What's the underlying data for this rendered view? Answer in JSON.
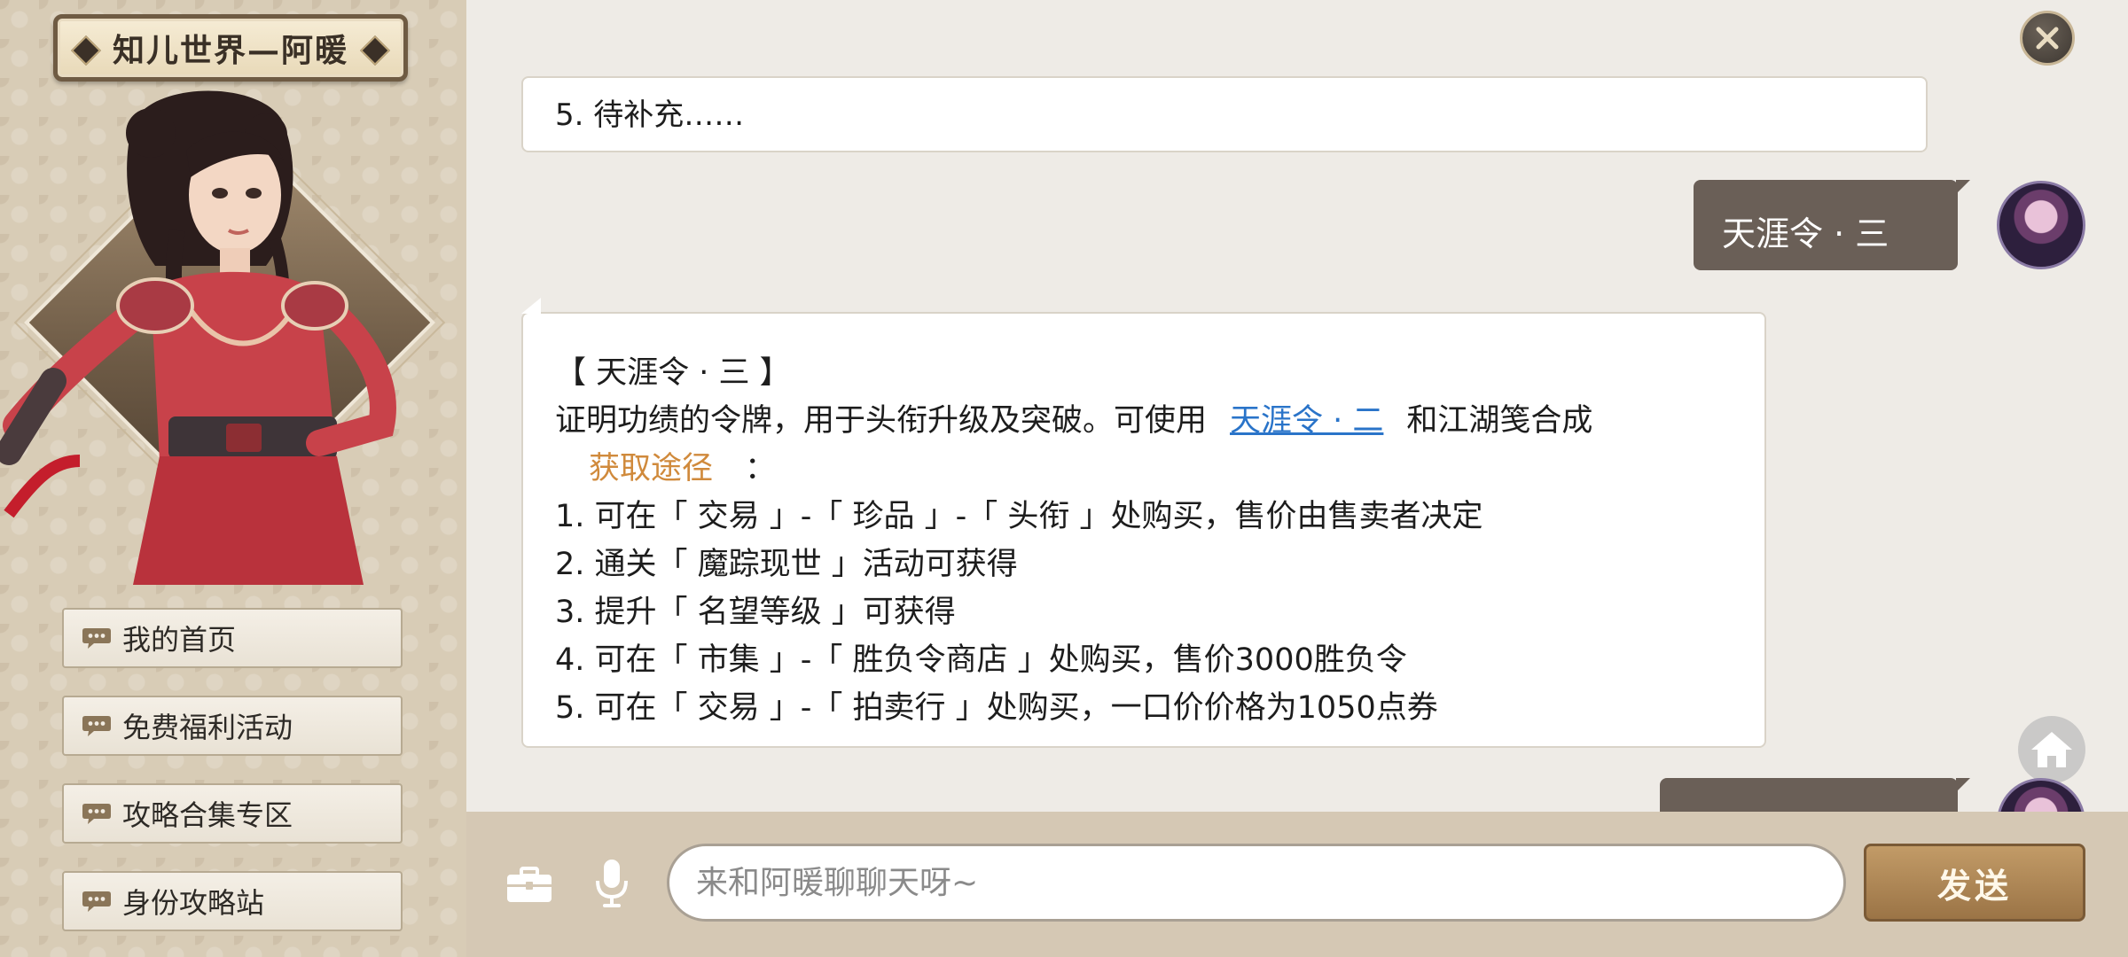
{
  "sidebar": {
    "title": "知儿世界—阿暖",
    "menu": [
      {
        "label": "我的首页"
      },
      {
        "label": "免费福利活动"
      },
      {
        "label": "攻略合集专区"
      },
      {
        "label": "身份攻略站"
      }
    ]
  },
  "chat": {
    "top_card_text": "5. 待补充……",
    "user_message_1": "天涯令 · 三",
    "main_card": {
      "heading": "【 天涯令 · 三 】",
      "desc_before": "证明功绩的令牌，用于头衔升级及突破。可使用",
      "desc_link": "天涯令 · 二",
      "desc_after": "和江湖笺合成",
      "obtain_label": "获取途径",
      "obtain_colon": "：",
      "items": [
        "1. 可在「 交易 」-「 珍品 」-「 头衔 」处购买，售价由售卖者决定",
        "2. 通关「 魔踪现世 」活动可获得",
        "3. 提升「 名望等级 」可获得",
        "4. 可在「 市集 」-「 胜负令商店 」处购买，售价3000胜负令",
        "5. 可在「 交易 」-「 拍卖行 」处购买，一口价价格为1050点券"
      ]
    }
  },
  "input": {
    "placeholder": "来和阿暖聊聊天呀~"
  },
  "send_label": "发送",
  "icons": {
    "close": "close-icon",
    "home": "home-icon",
    "toolbox": "toolbox-icon",
    "mic": "microphone-icon",
    "menu_bubble": "chat-bubble-icon"
  },
  "colors": {
    "link": "#2a74c9",
    "obtain": "#d08a3c",
    "user_bubble": "#6a5f57",
    "send_button": "#b08755"
  }
}
